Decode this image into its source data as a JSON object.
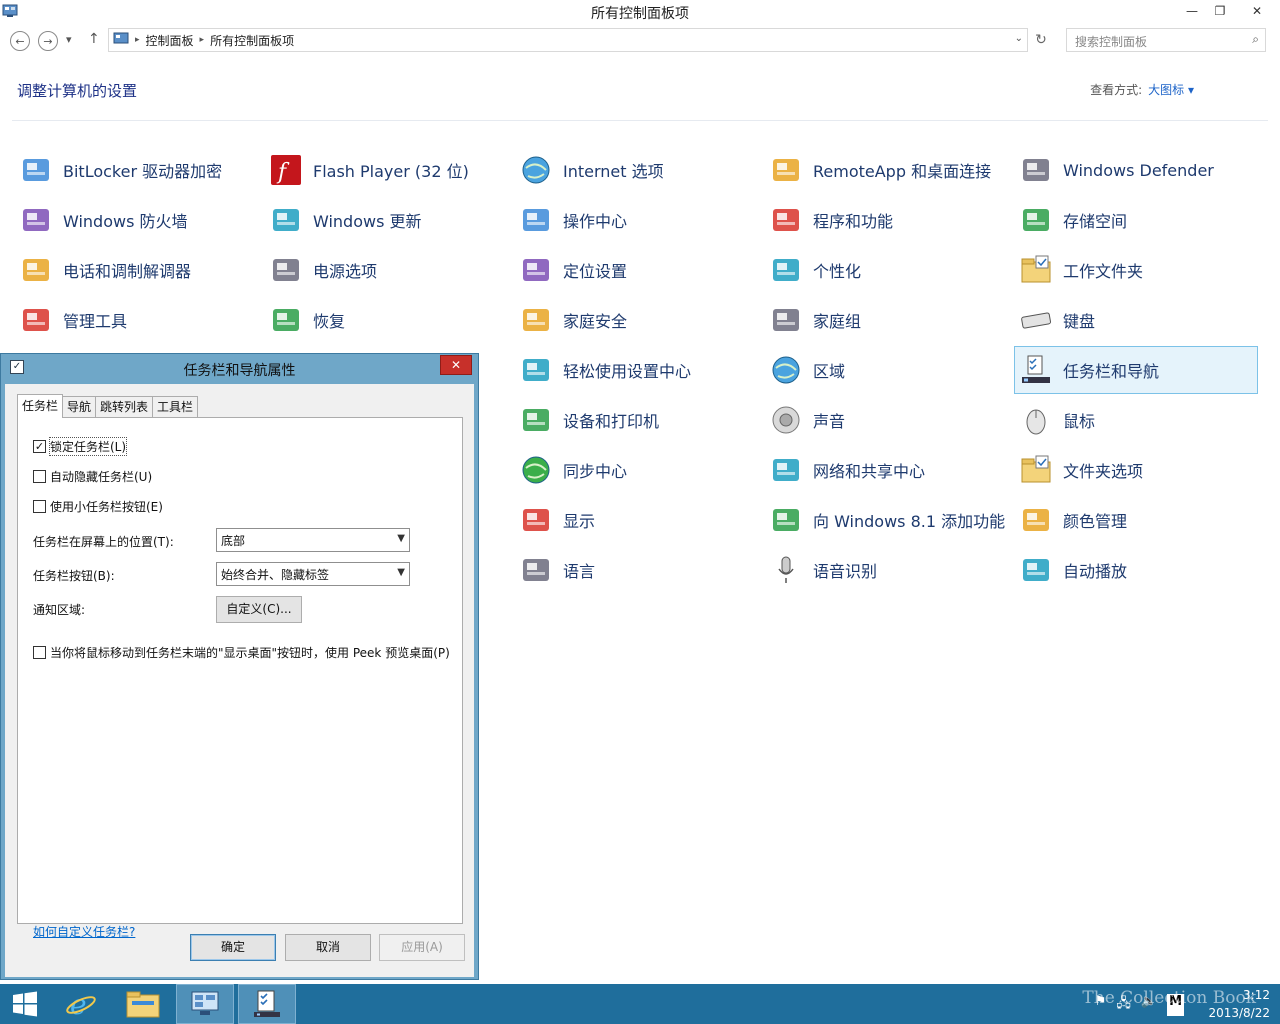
{
  "window": {
    "title": "所有控制面板项",
    "minimize": "—",
    "maximize": "❐",
    "close": "✕"
  },
  "nav": {
    "back": "←",
    "forward": "→",
    "recent": "▾",
    "up": "↑",
    "breadcrumbs": [
      "控制面板",
      "所有控制面板项"
    ],
    "search_placeholder": "搜索控制面板"
  },
  "header": {
    "title": "调整计算机的设置",
    "view_by_label": "查看方式:",
    "view_by_value": "大图标 ▾"
  },
  "items": [
    {
      "label": "BitLocker 驱动器加密",
      "icon": "key-icon"
    },
    {
      "label": "Flash Player (32 位)",
      "icon": "flash-icon"
    },
    {
      "label": "Internet 选项",
      "icon": "globe-icon"
    },
    {
      "label": "RemoteApp 和桌面连接",
      "icon": "remote-icon"
    },
    {
      "label": "Windows Defender",
      "icon": "wall-icon"
    },
    {
      "label": "Windows 防火墙",
      "icon": "firewall-icon"
    },
    {
      "label": "Windows 更新",
      "icon": "update-icon"
    },
    {
      "label": "操作中心",
      "icon": "flag-icon"
    },
    {
      "label": "程序和功能",
      "icon": "programs-icon"
    },
    {
      "label": "存储空间",
      "icon": "storage-icon"
    },
    {
      "label": "电话和调制解调器",
      "icon": "phone-icon"
    },
    {
      "label": "电源选项",
      "icon": "power-icon"
    },
    {
      "label": "定位设置",
      "icon": "location-icon"
    },
    {
      "label": "个性化",
      "icon": "personalize-icon"
    },
    {
      "label": "工作文件夹",
      "icon": "folder-icon"
    },
    {
      "label": "管理工具",
      "icon": "tools-icon"
    },
    {
      "label": "恢复",
      "icon": "recovery-icon"
    },
    {
      "label": "家庭安全",
      "icon": "family-icon"
    },
    {
      "label": "家庭组",
      "icon": "homegroup-icon"
    },
    {
      "label": "键盘",
      "icon": "keyboard-icon"
    },
    {
      "label": "轻松使用设置中心",
      "icon": "ease-icon"
    },
    {
      "label": "区域",
      "icon": "region-icon"
    },
    {
      "label": "任务栏和导航",
      "icon": "taskbar-icon"
    },
    {
      "label": "设备和打印机",
      "icon": "printer-icon"
    },
    {
      "label": "声音",
      "icon": "speaker-icon"
    },
    {
      "label": "鼠标",
      "icon": "mouse-icon"
    },
    {
      "label": "同步中心",
      "icon": "sync-icon"
    },
    {
      "label": "网络和共享中心",
      "icon": "network-icon"
    },
    {
      "label": "文件夹选项",
      "icon": "folder-options-icon"
    },
    {
      "label": "显示",
      "icon": "display-icon"
    },
    {
      "label": "向 Windows 8.1 添加功能",
      "icon": "addfeatures-icon"
    },
    {
      "label": "颜色管理",
      "icon": "color-icon"
    },
    {
      "label": "语言",
      "icon": "language-icon"
    },
    {
      "label": "语音识别",
      "icon": "mic-icon"
    },
    {
      "label": "自动播放",
      "icon": "autoplay-icon"
    }
  ],
  "dialog": {
    "title": "任务栏和导航属性",
    "close": "✕",
    "tabs": [
      "任务栏",
      "导航",
      "跳转列表",
      "工具栏"
    ],
    "lock_taskbar": "锁定任务栏(L)",
    "lock_taskbar_checked": true,
    "auto_hide": "自动隐藏任务栏(U)",
    "small_buttons": "使用小任务栏按钮(E)",
    "position_label": "任务栏在屏幕上的位置(T):",
    "position_value": "底部",
    "buttons_label": "任务栏按钮(B):",
    "buttons_value": "始终合并、隐藏标签",
    "notify_label": "通知区域:",
    "customize_button": "自定义(C)...",
    "peek": "当你将鼠标移动到任务栏末端的\"显示桌面\"按钮时，使用 Peek 预览桌面(P)",
    "help_link": "如何自定义任务栏?",
    "ok": "确定",
    "cancel": "取消",
    "apply": "应用(A)"
  },
  "taskbar": {
    "time": "3:12",
    "date": "2013/8/22",
    "watermark": "The Collection Book"
  },
  "colors": {
    "link": "#1e64c8",
    "title_blue": "#1e3287",
    "taskbar": "#1f6e9c",
    "dialog_frame": "#6fa7c8",
    "selected_bg": "#e5f3fb",
    "close_red": "#c7302a"
  }
}
